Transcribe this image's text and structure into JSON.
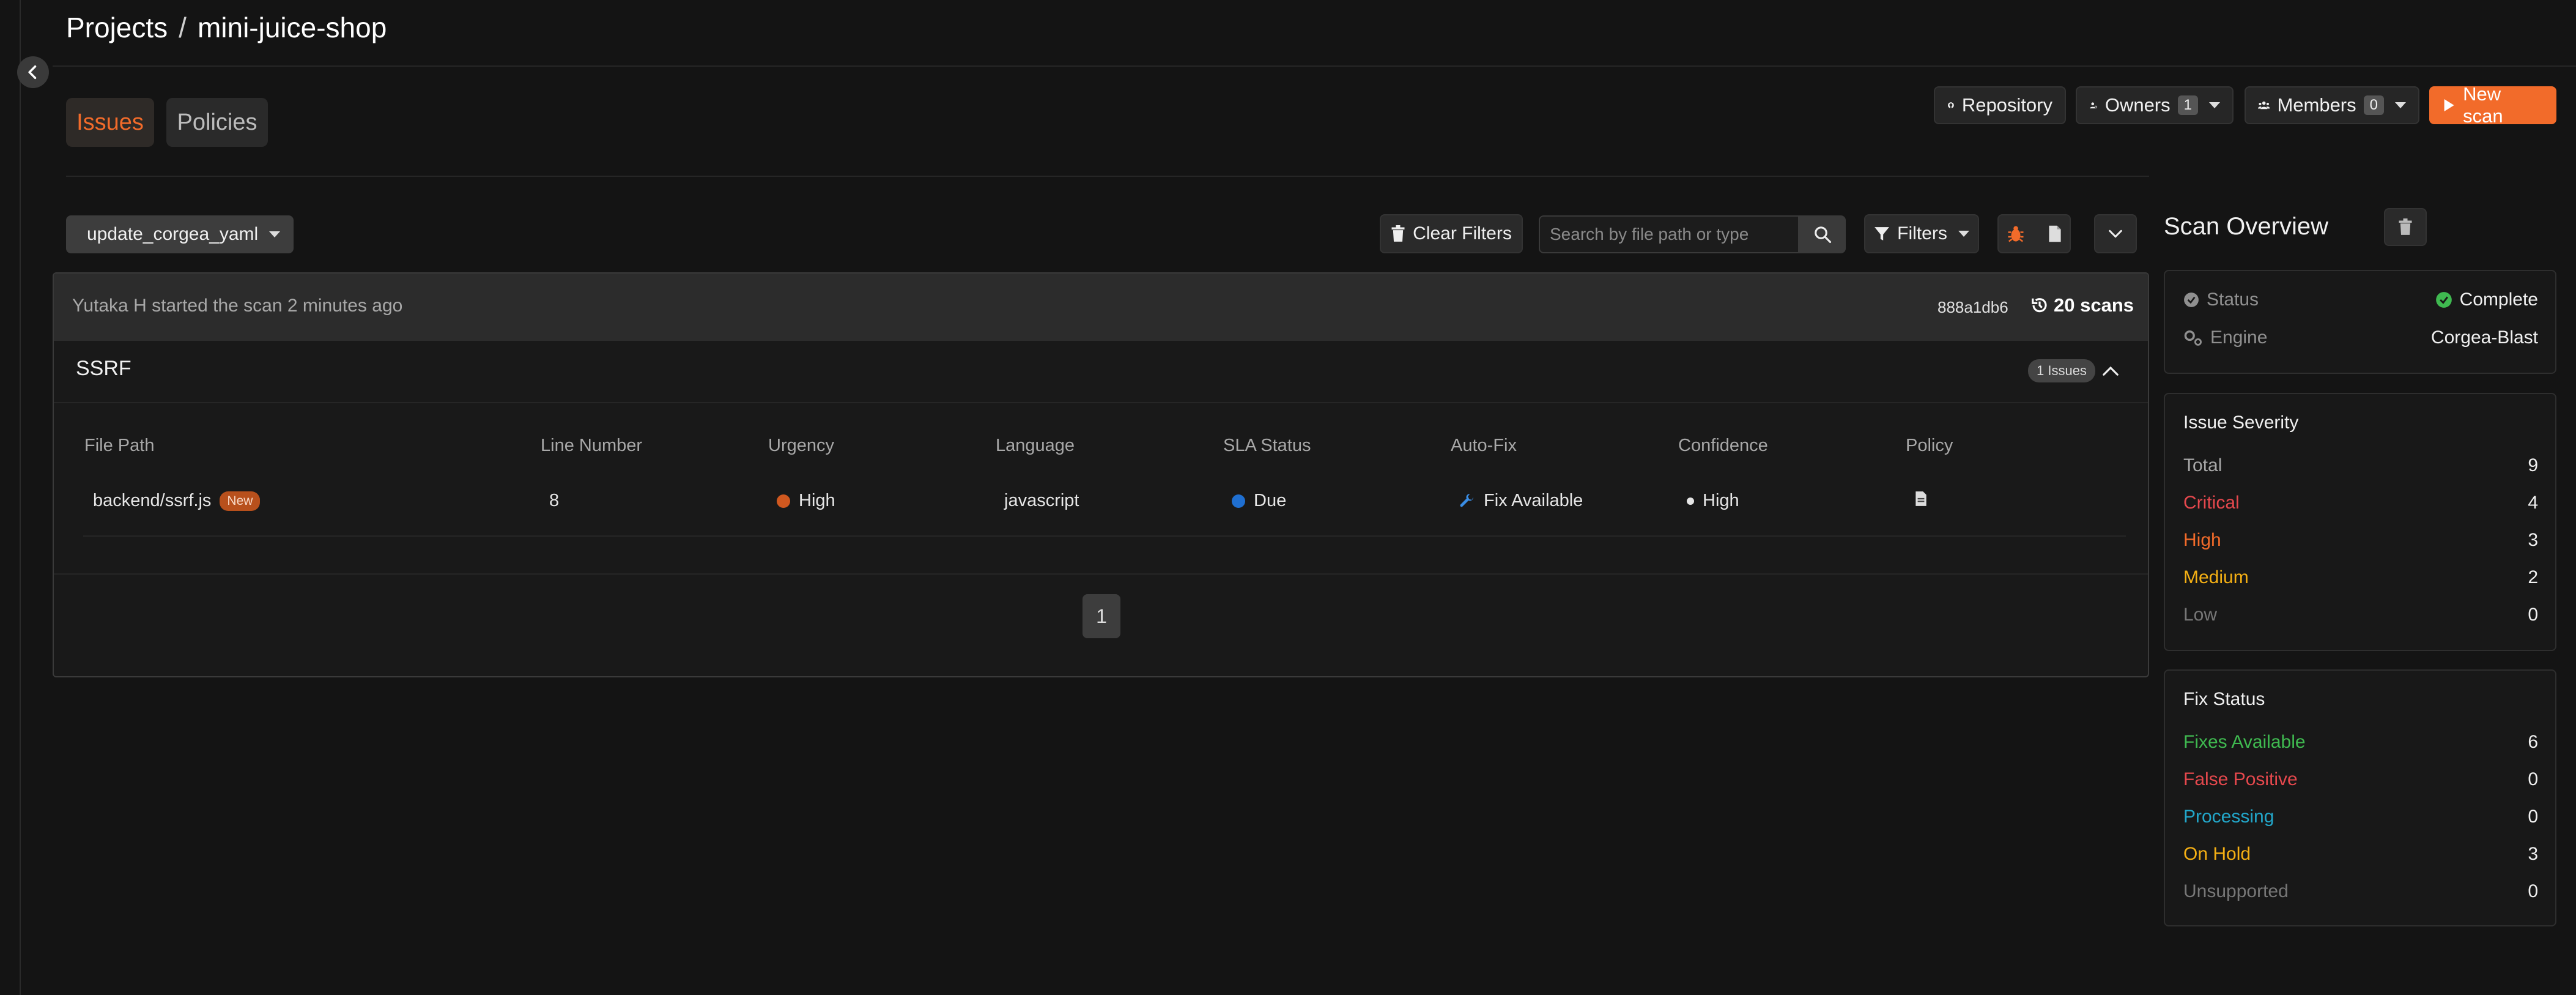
{
  "breadcrumb": {
    "root": "Projects",
    "separator": "/",
    "project": "mini-juice-shop"
  },
  "tabs": [
    {
      "label": "Issues",
      "active": true
    },
    {
      "label": "Policies",
      "active": false
    }
  ],
  "header_buttons": {
    "repository": "Repository",
    "owners": "Owners",
    "owners_count": "1",
    "members": "Members",
    "members_count": "0",
    "new_scan": "New scan"
  },
  "toolbar": {
    "branch": "update_corgea_yaml",
    "clear_filters": "Clear Filters",
    "search_placeholder": "Search by file path or type",
    "filters": "Filters"
  },
  "scan": {
    "started_by": "Yutaka H started the scan 2 minutes ago",
    "commit": "888a1db6",
    "scan_count": "20 scans"
  },
  "group": {
    "title": "SSRF",
    "issues_badge": "1 Issues"
  },
  "table": {
    "columns": [
      "File Path",
      "Line Number",
      "Urgency",
      "Language",
      "SLA Status",
      "Auto-Fix",
      "Confidence",
      "Policy"
    ],
    "rows": [
      {
        "file_path": "backend/ssrf.js",
        "new_badge": "New",
        "line_number": "8",
        "urgency": "High",
        "language": "javascript",
        "sla_status": "Due",
        "auto_fix": "Fix Available",
        "confidence": "High"
      }
    ]
  },
  "pagination": {
    "current": "1"
  },
  "scan_overview": {
    "title": "Scan Overview",
    "status_label": "Status",
    "status_value": "Complete",
    "engine_label": "Engine",
    "engine_value": "Corgea-Blast"
  },
  "issue_severity": {
    "title": "Issue Severity",
    "rows": [
      {
        "label": "Total",
        "value": "9",
        "color": "#a8a8a8"
      },
      {
        "label": "Critical",
        "value": "4",
        "color": "#e5484d"
      },
      {
        "label": "High",
        "value": "3",
        "color": "#f26b2a"
      },
      {
        "label": "Medium",
        "value": "2",
        "color": "#f5b014"
      },
      {
        "label": "Low",
        "value": "0",
        "color": "#777777"
      }
    ]
  },
  "fix_status": {
    "title": "Fix Status",
    "rows": [
      {
        "label": "Fixes Available",
        "value": "6",
        "color": "#3fb950"
      },
      {
        "label": "False Positive",
        "value": "0",
        "color": "#e5484d"
      },
      {
        "label": "Processing",
        "value": "0",
        "color": "#22a6c9"
      },
      {
        "label": "On Hold",
        "value": "3",
        "color": "#f5b014"
      },
      {
        "label": "Unsupported",
        "value": "0",
        "color": "#777777"
      }
    ]
  },
  "colors": {
    "accent": "#f26b2a",
    "background": "#141414",
    "complete": "#3fb950",
    "urgency_high": "#d0581f",
    "sla_due": "#1f6fd1",
    "fix_icon": "#3a8ee6"
  }
}
